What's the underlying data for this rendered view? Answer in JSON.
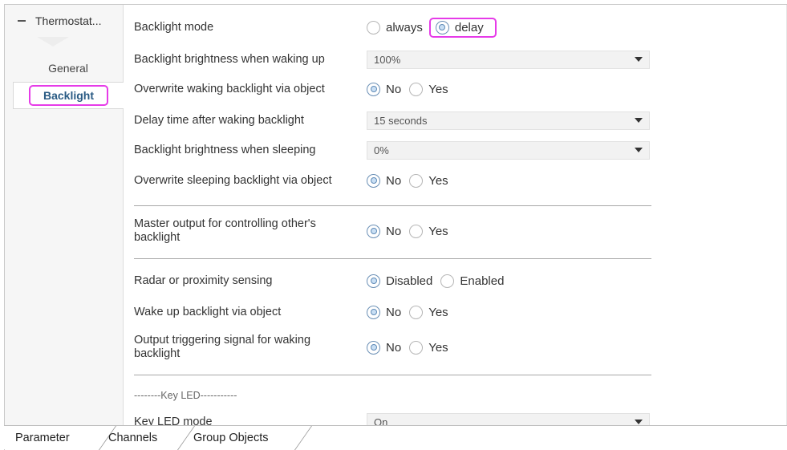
{
  "tree": {
    "root_label": "Thermostat...",
    "items": [
      {
        "label": "General"
      },
      {
        "label": "Backlight"
      }
    ]
  },
  "params": {
    "backlight_mode": {
      "label": "Backlight mode",
      "options": [
        "always",
        "delay"
      ],
      "selected": "delay"
    },
    "waking_brightness": {
      "label": "Backlight brightness when waking up",
      "value": "100%"
    },
    "overwrite_waking": {
      "label": "Overwrite waking backlight via object",
      "options": [
        "No",
        "Yes"
      ],
      "selected": "No"
    },
    "delay_time": {
      "label": "Delay time after waking backlight",
      "value": "15 seconds"
    },
    "sleeping_brightness": {
      "label": "Backlight brightness when sleeping",
      "value": "0%"
    },
    "overwrite_sleeping": {
      "label": "Overwrite sleeping backlight via object",
      "options": [
        "No",
        "Yes"
      ],
      "selected": "No"
    },
    "master_output": {
      "label": "Master output for controlling other's backlight",
      "options": [
        "No",
        "Yes"
      ],
      "selected": "No"
    },
    "radar": {
      "label": "Radar or proximity sensing",
      "options": [
        "Disabled",
        "Enabled"
      ],
      "selected": "Disabled"
    },
    "wake_via_object": {
      "label": "Wake up backlight via object",
      "options": [
        "No",
        "Yes"
      ],
      "selected": "No"
    },
    "output_trigger": {
      "label": "Output triggering signal for waking backlight",
      "options": [
        "No",
        "Yes"
      ],
      "selected": "No"
    },
    "key_led_heading": "--------Key LED-----------",
    "key_led_mode": {
      "label": "Key LED mode",
      "value": "On"
    }
  },
  "tabs": [
    "Parameter",
    "Channels",
    "Group Objects"
  ],
  "colors": {
    "highlight": "#e63be8",
    "active_text": "#2a5b84"
  }
}
